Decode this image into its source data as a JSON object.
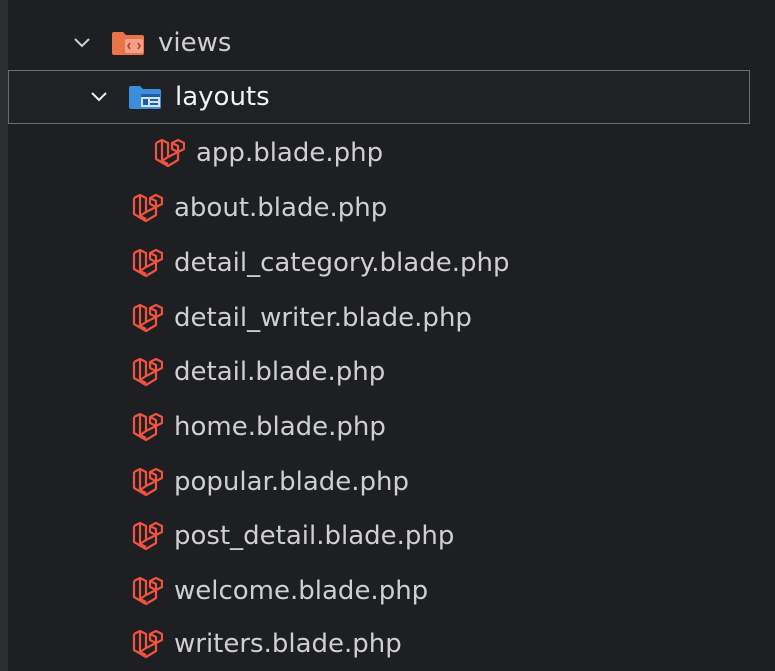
{
  "explorer": {
    "items": [
      {
        "label": "views",
        "type": "folder",
        "expanded": true,
        "icon": "views-folder-icon",
        "depth": 0
      },
      {
        "label": "layouts",
        "type": "folder",
        "expanded": true,
        "selected": true,
        "icon": "layouts-folder-icon",
        "depth": 1
      },
      {
        "label": "app.blade.php",
        "type": "file",
        "icon": "laravel-blade-icon",
        "depth": 2
      },
      {
        "label": "about.blade.php",
        "type": "file",
        "icon": "laravel-blade-icon",
        "depth": 1
      },
      {
        "label": "detail_category.blade.php",
        "type": "file",
        "icon": "laravel-blade-icon",
        "depth": 1
      },
      {
        "label": "detail_writer.blade.php",
        "type": "file",
        "icon": "laravel-blade-icon",
        "depth": 1
      },
      {
        "label": "detail.blade.php",
        "type": "file",
        "icon": "laravel-blade-icon",
        "depth": 1
      },
      {
        "label": "home.blade.php",
        "type": "file",
        "icon": "laravel-blade-icon",
        "depth": 1
      },
      {
        "label": "popular.blade.php",
        "type": "file",
        "icon": "laravel-blade-icon",
        "depth": 1
      },
      {
        "label": "post_detail.blade.php",
        "type": "file",
        "icon": "laravel-blade-icon",
        "depth": 1
      },
      {
        "label": "welcome.blade.php",
        "type": "file",
        "icon": "laravel-blade-icon",
        "depth": 1
      },
      {
        "label": "writers.blade.php",
        "type": "file",
        "icon": "laravel-blade-icon",
        "depth": 1
      }
    ]
  },
  "colors": {
    "background": "#1e1f22",
    "text": "#cfcfcf",
    "laravel_red": "#f05340",
    "folder_orange": "#e8744a",
    "folder_blue": "#3c8ddc",
    "selection_border": "#6b6d70"
  }
}
